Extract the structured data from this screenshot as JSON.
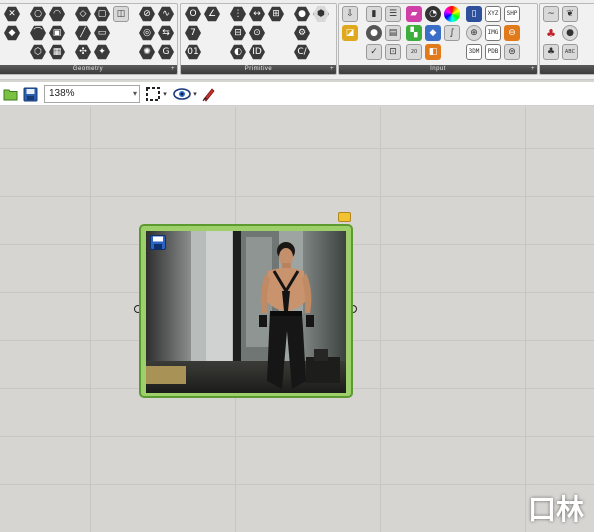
{
  "ribbon": {
    "panels": [
      {
        "id": "geometry",
        "label": "Geometry"
      },
      {
        "id": "primitive",
        "label": "Primitive"
      },
      {
        "id": "input",
        "label": "Input"
      },
      {
        "id": "util",
        "label": ""
      }
    ],
    "expand_glyph": "+",
    "input_labels": {
      "xyz": "XYZ",
      "shp": "SHP",
      "img": "IMG",
      "pdb": "PDB",
      "num": "20",
      "3dm": "3DM",
      "abc": "ABC",
      "id": "ID",
      "seven": "7",
      "zero_one": "01",
      "c_slash": "C/"
    }
  },
  "toolbar": {
    "zoom_value": "138%",
    "dropdown_arrow": "▾"
  },
  "viewer": {
    "save_icon": "floppy-disk-icon",
    "image_desc_icon": "photo-content"
  },
  "watermark": {
    "text": "口林"
  },
  "colors": {
    "component_border": "#5d9b32",
    "component_fill": "#9ed06a",
    "canvas": "#d6d5d1",
    "ribbon_footer": "#4a4a4a"
  }
}
